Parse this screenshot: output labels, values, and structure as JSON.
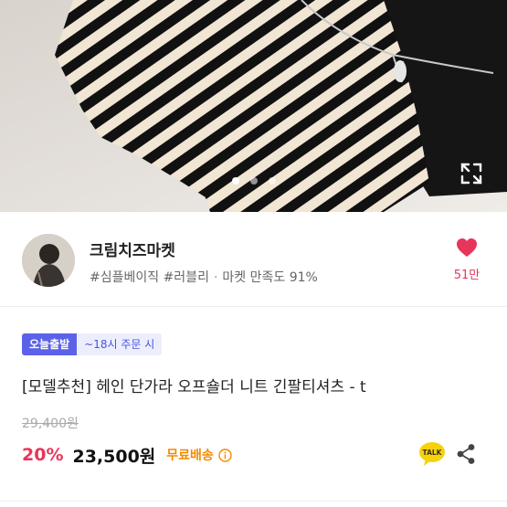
{
  "gallery": {
    "current_index": 1,
    "total": 3
  },
  "seller": {
    "name": "크림치즈마켓",
    "tags": "#심플베이직 #러블리",
    "satisfaction": "마켓 만족도 91%",
    "likes": "51만"
  },
  "product": {
    "badge_today": "오늘출발",
    "badge_time": "~18시 주문 시",
    "title": "[모델추천] 헤인 단가라 오프숄더 니트 긴팔티셔츠 - t",
    "original_price": "29,400원",
    "discount": "20%",
    "price": "23,500원",
    "shipping": "무료배송"
  },
  "actions": {
    "talk_label": "TALK"
  },
  "colors": {
    "accent_pink": "#e8355a",
    "badge_blue": "#5b62e8",
    "shipping_orange": "#f08c00",
    "talk_yellow": "#f5d20c"
  },
  "icons": {
    "expand": "expand-icon",
    "heart": "heart-icon",
    "info": "info-icon",
    "talk": "talk-icon",
    "share": "share-icon"
  }
}
